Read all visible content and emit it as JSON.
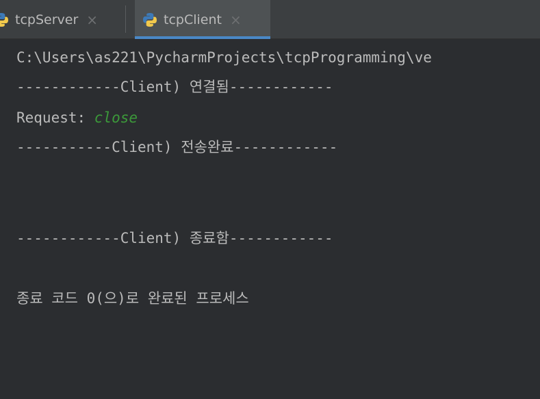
{
  "tabs": [
    {
      "label": "tcpServer",
      "icon": "python-icon",
      "close": "×"
    },
    {
      "label": "tcpClient",
      "icon": "python-icon",
      "close": "×",
      "active": true
    }
  ],
  "console": {
    "path_line": "C:\\Users\\as221\\PycharmProjects\\tcpProgramming\\ve",
    "connected_line": "------------Client) 연결됨------------",
    "request_label": "Request: ",
    "request_value": "close",
    "sent_line": "-----------Client) 전송완료------------",
    "terminated_line": "------------Client) 종료함------------",
    "exit_line": "종료 코드 0(으)로 완료된 프로세스"
  },
  "colors": {
    "background": "#2b2d30",
    "text": "#bbbbbb",
    "request_value": "#3c9a3a",
    "active_tab_underline": "#4a88c7"
  }
}
